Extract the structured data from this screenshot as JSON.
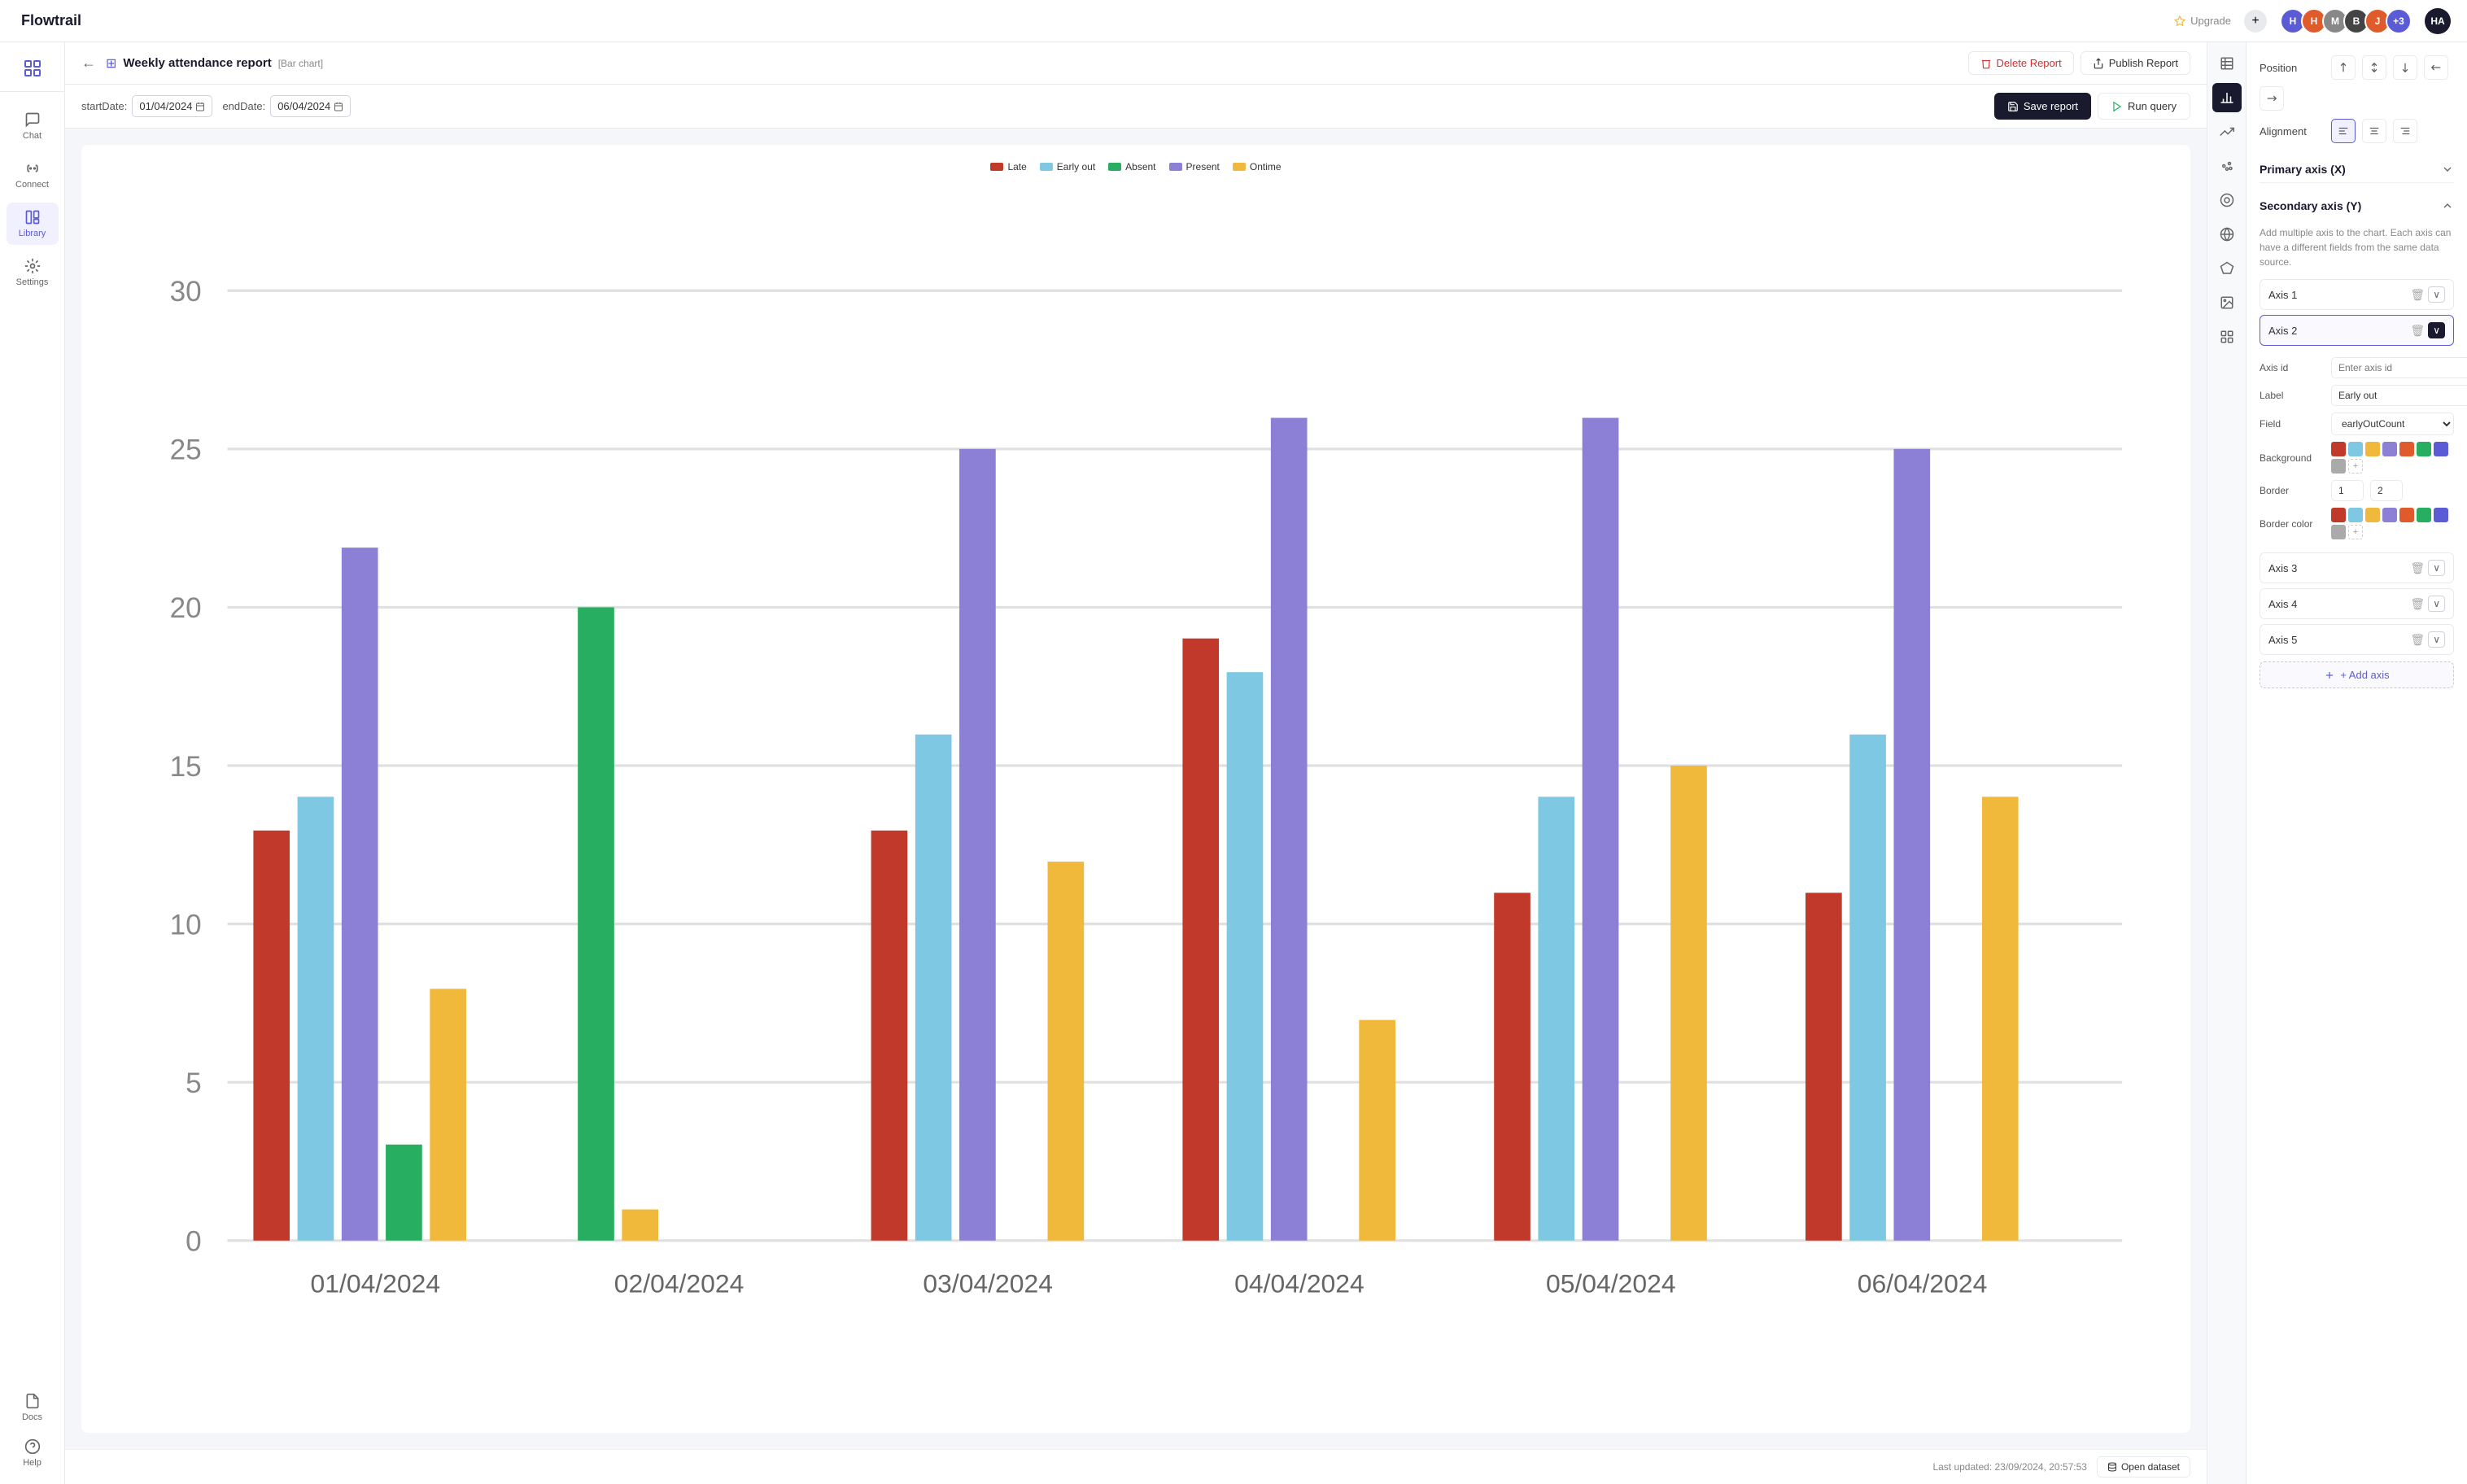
{
  "app": {
    "name": "Flowtrail",
    "upgrade_label": "Upgrade"
  },
  "topbar": {
    "users": [
      {
        "initials": "H",
        "color": "#5b5bd6"
      },
      {
        "initials": "H",
        "color": "#e05b2b"
      },
      {
        "initials": "M",
        "color": "#888"
      },
      {
        "initials": "B",
        "color": "#444"
      },
      {
        "initials": "J",
        "color": "#e05b2b"
      },
      {
        "initials": "+3",
        "color": "#5b5bd6"
      }
    ]
  },
  "sidebar": {
    "items": [
      {
        "label": "Chat",
        "icon": "chat"
      },
      {
        "label": "Connect",
        "icon": "connect"
      },
      {
        "label": "Library",
        "icon": "library"
      },
      {
        "label": "Settings",
        "icon": "settings"
      }
    ],
    "bottom_items": [
      {
        "label": "Docs",
        "icon": "docs"
      },
      {
        "label": "Help",
        "icon": "help"
      }
    ]
  },
  "report": {
    "back_label": "←",
    "icon_label": "⊞",
    "title": "Weekly attendance report",
    "subtitle": "[Bar chart]",
    "delete_label": "Delete Report",
    "publish_label": "Publish Report"
  },
  "filters": {
    "start_label": "startDate:",
    "start_value": "01/04/2024",
    "end_label": "endDate:",
    "end_value": "06/04/2024",
    "save_label": "Save report",
    "run_label": "Run query"
  },
  "chart": {
    "legend": [
      {
        "label": "Late",
        "color": "#c0392b"
      },
      {
        "label": "Early out",
        "color": "#7ec8e3"
      },
      {
        "label": "Absent",
        "color": "#27ae60"
      },
      {
        "label": "Present",
        "color": "#8b7fd6"
      },
      {
        "label": "Ontime",
        "color": "#f0b93b"
      }
    ],
    "y_max": 30,
    "y_labels": [
      0,
      5,
      10,
      15,
      20,
      25,
      30
    ],
    "x_labels": [
      "01/04/2024",
      "02/04/2024",
      "03/04/2024",
      "04/04/2024",
      "05/04/2024",
      "06/04/2024"
    ],
    "groups": [
      {
        "date": "01/04/2024",
        "bars": [
          {
            "label": "Late",
            "value": 13,
            "color": "#c0392b"
          },
          {
            "label": "Early out",
            "value": 14,
            "color": "#7ec8e3"
          },
          {
            "label": "Present",
            "value": 22,
            "color": "#8b7fd6"
          },
          {
            "label": "Absent",
            "value": 3,
            "color": "#27ae60"
          },
          {
            "label": "Ontime",
            "value": 8,
            "color": "#f0b93b"
          }
        ]
      },
      {
        "date": "02/04/2024",
        "bars": [
          {
            "label": "Late",
            "value": 0,
            "color": "#c0392b"
          },
          {
            "label": "Early out",
            "value": 0,
            "color": "#7ec8e3"
          },
          {
            "label": "Present",
            "value": 0,
            "color": "#8b7fd6"
          },
          {
            "label": "Absent",
            "value": 20,
            "color": "#27ae60"
          },
          {
            "label": "Ontime",
            "value": 1,
            "color": "#f0b93b"
          }
        ]
      },
      {
        "date": "03/04/2024",
        "bars": [
          {
            "label": "Late",
            "value": 13,
            "color": "#c0392b"
          },
          {
            "label": "Early out",
            "value": 16,
            "color": "#7ec8e3"
          },
          {
            "label": "Present",
            "value": 25,
            "color": "#8b7fd6"
          },
          {
            "label": "Absent",
            "value": 0,
            "color": "#27ae60"
          },
          {
            "label": "Ontime",
            "value": 12,
            "color": "#f0b93b"
          }
        ]
      },
      {
        "date": "04/04/2024",
        "bars": [
          {
            "label": "Late",
            "value": 19,
            "color": "#c0392b"
          },
          {
            "label": "Early out",
            "value": 18,
            "color": "#7ec8e3"
          },
          {
            "label": "Present",
            "value": 26,
            "color": "#8b7fd6"
          },
          {
            "label": "Absent",
            "value": 0,
            "color": "#27ae60"
          },
          {
            "label": "Ontime",
            "value": 7,
            "color": "#f0b93b"
          }
        ]
      },
      {
        "date": "05/04/2024",
        "bars": [
          {
            "label": "Late",
            "value": 11,
            "color": "#c0392b"
          },
          {
            "label": "Early out",
            "value": 14,
            "color": "#7ec8e3"
          },
          {
            "label": "Present",
            "value": 26,
            "color": "#8b7fd6"
          },
          {
            "label": "Absent",
            "value": 0,
            "color": "#27ae60"
          },
          {
            "label": "Ontime",
            "value": 15,
            "color": "#f0b93b"
          }
        ]
      },
      {
        "date": "06/04/2024",
        "bars": [
          {
            "label": "Late",
            "value": 11,
            "color": "#c0392b"
          },
          {
            "label": "Early out",
            "value": 16,
            "color": "#7ec8e3"
          },
          {
            "label": "Present",
            "value": 25,
            "color": "#8b7fd6"
          },
          {
            "label": "Absent",
            "value": 0,
            "color": "#27ae60"
          },
          {
            "label": "Ontime",
            "value": 14,
            "color": "#f0b93b"
          }
        ]
      }
    ]
  },
  "footer": {
    "last_updated_label": "Last updated: 23/09/2024, 20:57:53",
    "open_dataset_label": "Open dataset"
  },
  "properties": {
    "position_label": "Position",
    "alignment_label": "Alignment",
    "primary_axis_label": "Primary axis (X)",
    "secondary_axis_label": "Secondary axis (Y)",
    "axis_description": "Add multiple axis to the chart. Each axis can have a different fields from the same data source.",
    "axes": [
      {
        "label": "Axis 1",
        "expanded": false
      },
      {
        "label": "Axis 2",
        "expanded": true
      },
      {
        "label": "Axis 3",
        "expanded": false
      },
      {
        "label": "Axis 4",
        "expanded": false
      },
      {
        "label": "Axis 5",
        "expanded": false
      }
    ],
    "axis2_detail": {
      "axis_id_label": "Axis id",
      "axis_id_placeholder": "Enter axis id",
      "label_label": "Label",
      "label_value": "Early out",
      "field_label": "Field",
      "field_value": "earlyOutCount",
      "background_label": "Background",
      "border_label": "Border",
      "border_value1": "1",
      "border_value2": "2",
      "border_color_label": "Border color"
    },
    "background_colors": [
      "#c0392b",
      "#7ec8e3",
      "#f0b93b",
      "#8b7fd6",
      "#e05b2b",
      "#27ae60",
      "#5b5bd6",
      "#aaaaaa",
      "#ffffff"
    ],
    "border_colors": [
      "#c0392b",
      "#7ec8e3",
      "#f0b93b",
      "#8b7fd6",
      "#e05b2b",
      "#27ae60",
      "#5b5bd6",
      "#aaaaaa",
      "#ffffff"
    ],
    "add_axis_label": "+ Add axis"
  }
}
